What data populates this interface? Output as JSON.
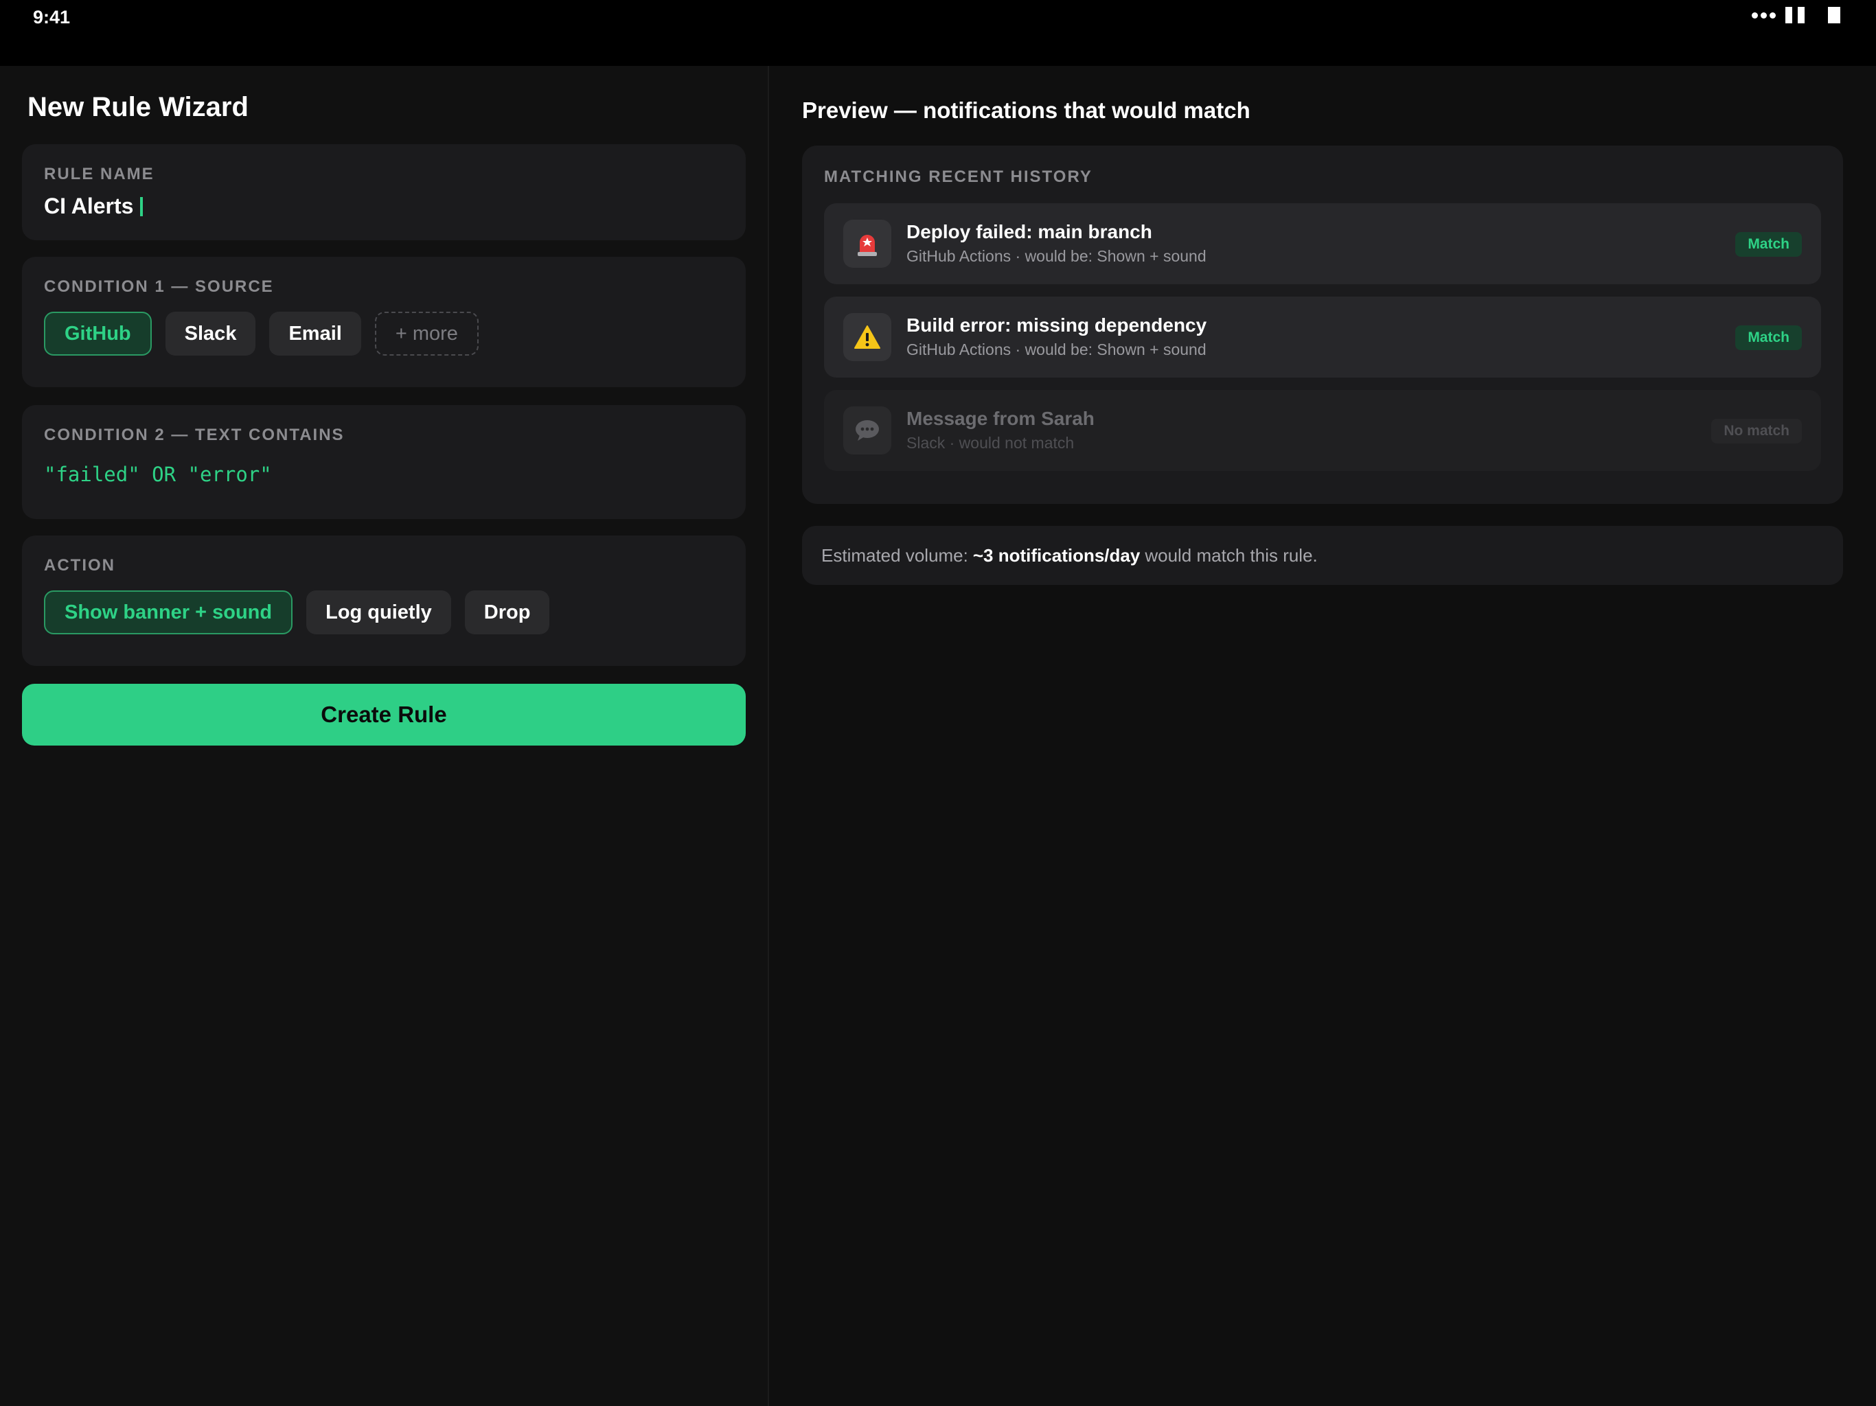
{
  "status_bar": {
    "time": "9:41"
  },
  "wizard": {
    "title": "New Rule Wizard",
    "rule_name": {
      "label": "RULE NAME",
      "value": "CI Alerts"
    },
    "condition1": {
      "label": "CONDITION 1 — SOURCE",
      "chips": [
        {
          "label": "GitHub",
          "selected": true
        },
        {
          "label": "Slack",
          "selected": false
        },
        {
          "label": "Email",
          "selected": false
        },
        {
          "label": "+ more",
          "selected": false
        }
      ]
    },
    "condition2": {
      "label": "CONDITION 2 — TEXT CONTAINS",
      "expression": "\"failed\" OR \"error\""
    },
    "action": {
      "label": "ACTION",
      "chips": [
        {
          "label": "Show banner + sound",
          "selected": true
        },
        {
          "label": "Log quietly",
          "selected": false
        },
        {
          "label": "Drop",
          "selected": false
        }
      ]
    },
    "create_button": "Create Rule"
  },
  "preview": {
    "title": "Preview — notifications that would match",
    "history_label": "MATCHING RECENT HISTORY",
    "items": [
      {
        "icon": "siren-icon",
        "title": "Deploy failed: main branch",
        "subtitle": "GitHub Actions · would be: Shown + sound",
        "badge": "Match",
        "matched": true
      },
      {
        "icon": "warning-icon",
        "title": "Build error: missing dependency",
        "subtitle": "GitHub Actions · would be: Shown + sound",
        "badge": "Match",
        "matched": true
      },
      {
        "icon": "chat-bubble-icon",
        "title": "Message from Sarah",
        "subtitle": "Slack · would not match",
        "badge": "No match",
        "matched": false
      }
    ],
    "volume": {
      "prefix": "Estimated volume:",
      "value": "~3 notifications/day",
      "suffix": "would match this rule."
    }
  },
  "colors": {
    "accent": "#2ed286",
    "button": "#2ecf86",
    "card": "#1b1b1d",
    "background": "#0f0f0f"
  }
}
